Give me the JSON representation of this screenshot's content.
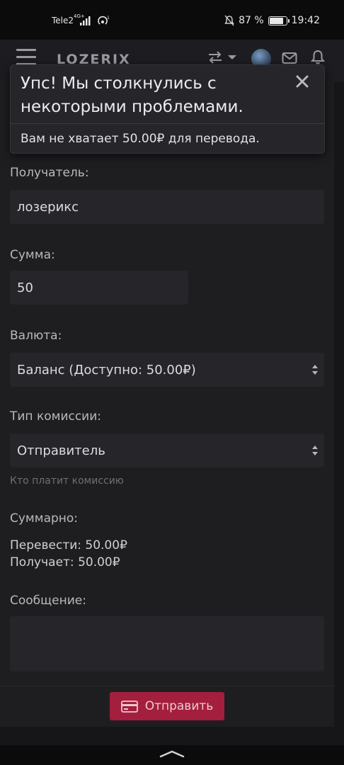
{
  "status_bar": {
    "carrier": "Tele2",
    "network": "4G+",
    "battery_percent": 87,
    "battery_text": "87 %",
    "time": "19:42"
  },
  "nav": {
    "logo": "LOZERIX",
    "icons": [
      "menu-icon",
      "transfer-icon",
      "avatar",
      "mail-icon",
      "bell-icon"
    ]
  },
  "alert": {
    "title": "Упс! Мы столкнулись с некоторыми проблемами.",
    "message": "Вам не хватает 50.00₽ для перевода."
  },
  "form": {
    "recipient_label": "Получатель:",
    "recipient_value": "лозерикс",
    "amount_label": "Сумма:",
    "amount_value": "50",
    "currency_label": "Валюта:",
    "currency_value": "Баланс (Доступно: 50.00₽)",
    "fee_label": "Тип комиссии:",
    "fee_value": "Отправитель",
    "fee_help": "Кто платит комиссию",
    "summary_label": "Суммарно:",
    "summary_send": "Перевести: 50.00₽",
    "summary_receive": "Получает: 50.00₽",
    "message_label": "Сообщение:",
    "message_value": "",
    "submit_label": "Отправить"
  },
  "colors": {
    "accent": "#a41f3d",
    "background": "#161618",
    "card": "#1e1e21",
    "field": "#26262a"
  }
}
